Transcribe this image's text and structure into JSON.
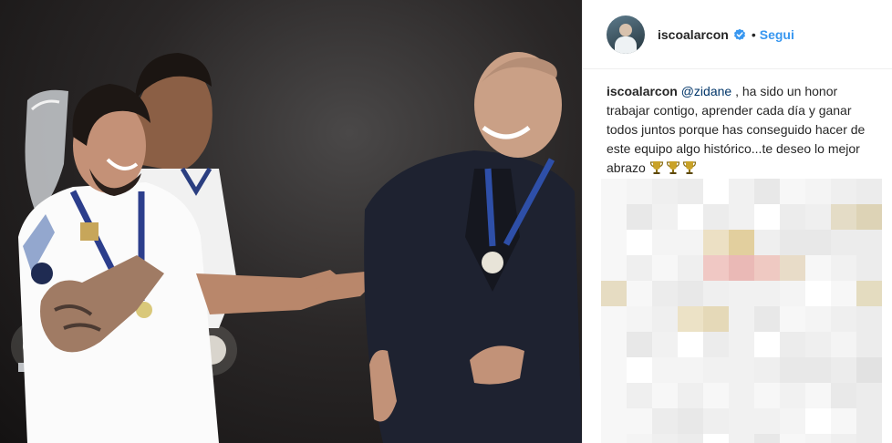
{
  "post": {
    "username": "iscoalarcon",
    "separator": "•",
    "follow_label": "Segui"
  },
  "caption": {
    "author": "iscoalarcon",
    "mention": "@zidane",
    "text": " , ha sido un honor trabajar contigo, aprender cada día y ganar todos juntos porque has conseguido hacer de este equipo algo histórico...te deseo lo mejor abrazo "
  },
  "colors": {
    "link_blue": "#3897f0",
    "verified_blue": "#3897f0",
    "text": "#262626"
  },
  "icons": {
    "verified": "verified-badge-icon",
    "trophy": "trophy-icon"
  }
}
